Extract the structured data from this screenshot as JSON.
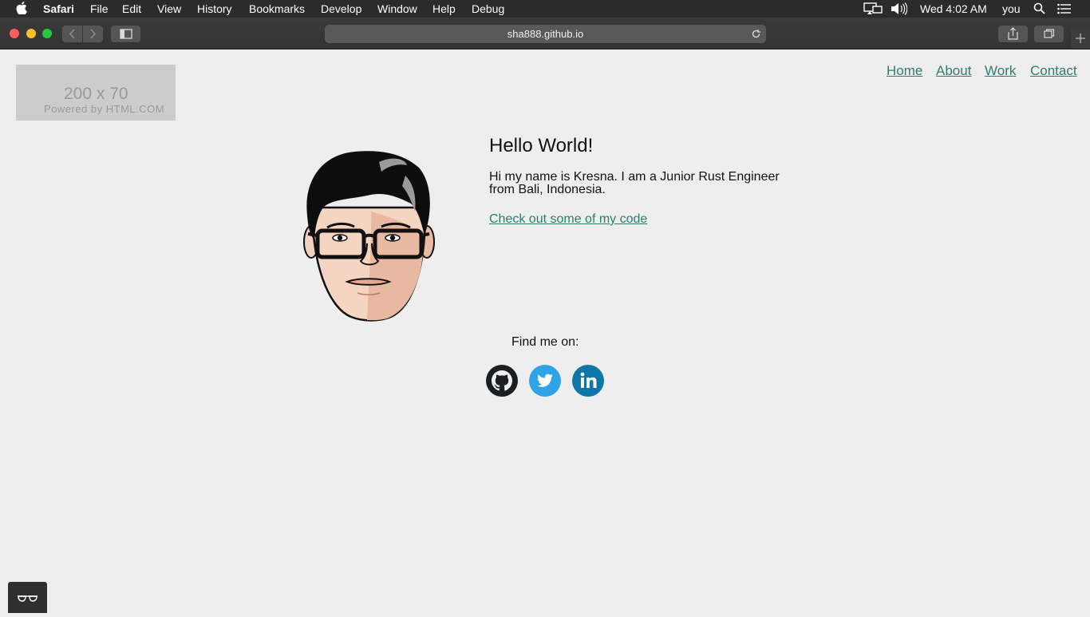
{
  "menubar": {
    "app": "Safari",
    "items": [
      "File",
      "Edit",
      "View",
      "History",
      "Bookmarks",
      "Develop",
      "Window",
      "Help",
      "Debug"
    ],
    "clock": "Wed 4:02 AM",
    "user": "you"
  },
  "browser": {
    "url": "sha888.github.io"
  },
  "placeholder": {
    "size_text": "200 x 70",
    "powered_text": "Powered by HTML.COM"
  },
  "nav": {
    "home": "Home",
    "about": "About",
    "work": "Work",
    "contact": "Contact"
  },
  "intro": {
    "heading": "Hello World!",
    "bio": "Hi my name is Kresna. I am a Junior Rust Engineer from Bali, Indonesia.",
    "code_link": "Check out some of my code"
  },
  "social": {
    "label": "Find me on:",
    "icons": [
      "github-icon",
      "twitter-icon",
      "linkedin-icon"
    ]
  },
  "colors": {
    "link": "#2e7d6b",
    "twitter": "#2ea3e6",
    "linkedin": "#0e76a8",
    "page_bg": "#eeeeee"
  }
}
